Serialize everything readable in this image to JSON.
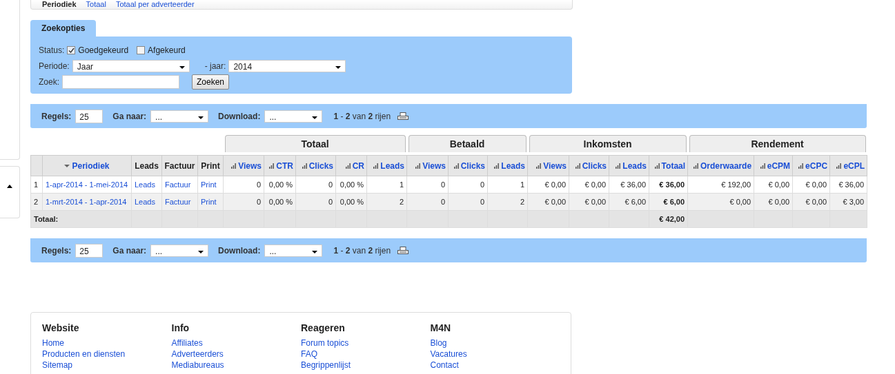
{
  "top_tabs": [
    {
      "label": "Periodiek",
      "selected": true
    },
    {
      "label": "Totaal",
      "selected": false
    },
    {
      "label": "Totaal per adverteerder",
      "selected": false
    }
  ],
  "search_options": {
    "tab": "Zoekopties",
    "status_label": "Status:",
    "statuses": [
      {
        "label": "Goedgekeurd",
        "checked": true
      },
      {
        "label": "Afgekeurd",
        "checked": false
      }
    ],
    "period_label": "Periode:",
    "period_value": "Jaar",
    "year_label": "- jaar:",
    "year_value": "2014",
    "search_label": "Zoek:",
    "search_button": "Zoeken"
  },
  "pagers": [
    {
      "rows_label": "Regels:",
      "rows_value": "25",
      "goto_label": "Ga naar:",
      "goto_value": "...",
      "download_label": "Download:",
      "download_value": "...",
      "summary": "**1** - **2** van **2** rijen"
    },
    {
      "rows_label": "Regels:",
      "rows_value": "25",
      "goto_label": "Ga naar:",
      "goto_value": "...",
      "download_label": "Download:",
      "download_value": "...",
      "summary": "**1** - **2** van **2** rijen"
    }
  ],
  "table": {
    "columns": [
      {
        "kind": "index"
      },
      {
        "kind": "sorted",
        "label": "Periodiek"
      },
      {
        "kind": "link",
        "label": "Leads"
      },
      {
        "kind": "link",
        "label": "Factuur"
      },
      {
        "kind": "link",
        "label": "Print"
      }
    ],
    "groups": [
      {
        "label": "Totaal",
        "columns": [
          {
            "kind": "stat",
            "label": "Views"
          },
          {
            "kind": "stat",
            "label": "CTR"
          },
          {
            "kind": "stat",
            "label": "Clicks"
          },
          {
            "kind": "stat",
            "label": "CR"
          },
          {
            "kind": "stat",
            "label": "Leads"
          }
        ]
      },
      {
        "label": "Betaald",
        "columns": [
          {
            "kind": "stat",
            "label": "Views"
          },
          {
            "kind": "stat",
            "label": "Clicks"
          },
          {
            "kind": "stat",
            "label": "Leads"
          }
        ]
      },
      {
        "label": "Inkomsten",
        "columns": [
          {
            "kind": "stat",
            "label": "Views"
          },
          {
            "kind": "stat",
            "label": "Clicks"
          },
          {
            "kind": "stat",
            "label": "Leads"
          },
          {
            "kind": "total",
            "label": "Totaal"
          }
        ]
      },
      {
        "label": "Rendement",
        "columns": [
          {
            "kind": "stat",
            "label": "Orderwaarde"
          },
          {
            "kind": "stat",
            "label": "eCPM"
          },
          {
            "kind": "stat",
            "label": "eCPC"
          },
          {
            "kind": "stat",
            "label": "eCPL"
          }
        ]
      }
    ],
    "rows": [
      [
        "1",
        "1-apr-2014 - 1-mei-2014",
        "Leads",
        "Factuur",
        "Print",
        "0",
        "0,00 %",
        "0",
        "0,00 %",
        "1",
        "0",
        "0",
        "1",
        "€ 0,00",
        "€ 0,00",
        "€ 36,00",
        "€ 36,00",
        "€ 192,00",
        "€ 0,00",
        "€ 0,00",
        "€ 36,00"
      ],
      [
        "2",
        "1-mrt-2014 - 1-apr-2014",
        "Leads",
        "Factuur",
        "Print",
        "0",
        "0,00 %",
        "0",
        "0,00 %",
        "2",
        "0",
        "0",
        "2",
        "€ 0,00",
        "€ 0,00",
        "€ 6,00",
        "€ 6,00",
        "€ 0,00",
        "€ 0,00",
        "€ 0,00",
        "€ 3,00"
      ]
    ],
    "total_row": {
      "label": "Totaal:",
      "total": "€ 42,00"
    }
  },
  "footer": [
    {
      "heading": "Website",
      "links": [
        "Home",
        "Producten en diensten",
        "Sitemap"
      ]
    },
    {
      "heading": "Info",
      "links": [
        "Affiliates",
        "Adverteerders",
        "Mediabureaus"
      ]
    },
    {
      "heading": "Reageren",
      "links": [
        "Forum topics",
        "FAQ",
        "Begrippenlijst"
      ]
    },
    {
      "heading": "M4N",
      "links": [
        "Blog",
        "Vacatures",
        "Contact"
      ]
    }
  ]
}
